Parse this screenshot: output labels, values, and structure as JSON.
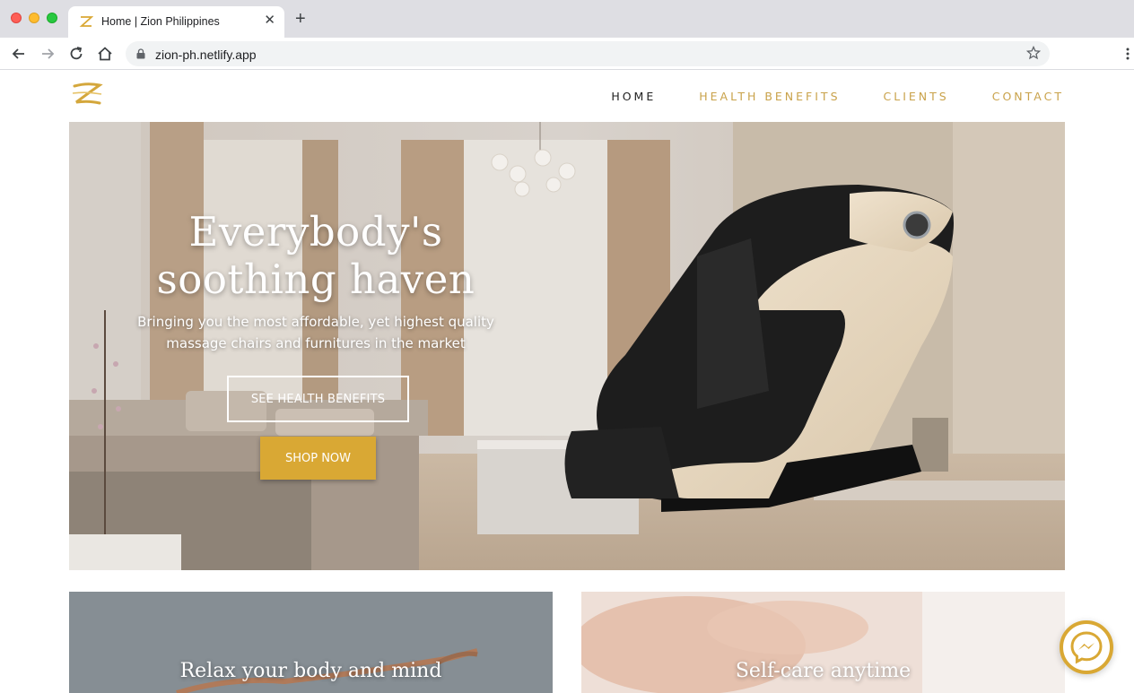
{
  "browser": {
    "tab_title": "Home | Zion Philippines",
    "url": "zion-ph.netlify.app"
  },
  "nav": {
    "items": [
      {
        "label": "HOME",
        "active": true
      },
      {
        "label": "HEALTH BENEFITS",
        "active": false
      },
      {
        "label": "CLIENTS",
        "active": false
      },
      {
        "label": "CONTACT",
        "active": false
      }
    ]
  },
  "hero": {
    "title_line1": "Everybody's",
    "title_line2": "soothing haven",
    "subtitle_line1": "Bringing you the most affordable, yet highest quality",
    "subtitle_line2": "massage chairs and furnitures in the market",
    "cta_outline": "SEE HEALTH BENEFITS",
    "cta_primary": "SHOP NOW"
  },
  "cards": [
    {
      "title": "Relax your body and mind"
    },
    {
      "title": "Self-care anytime"
    }
  ],
  "colors": {
    "accent_gold": "#d9a834",
    "nav_gold": "#c9a24a",
    "nav_active": "#222222"
  },
  "icons": {
    "logo": "gold-z-logo",
    "chat": "messenger-icon"
  }
}
